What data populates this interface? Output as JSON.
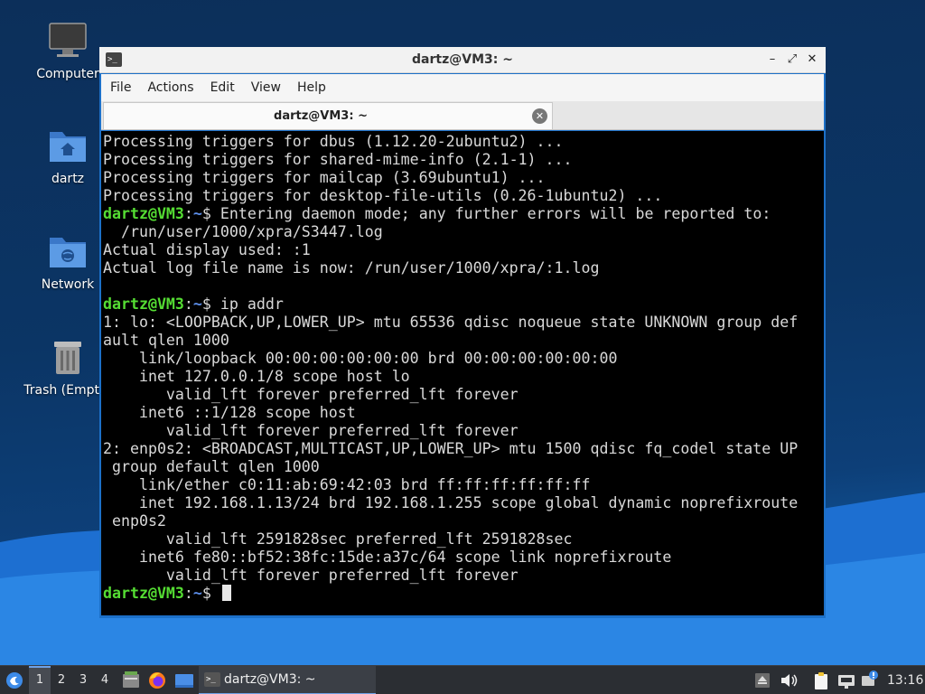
{
  "desktop": {
    "icons": [
      {
        "label": "Computer",
        "icon": "monitor-icon"
      },
      {
        "label": "dartz",
        "icon": "home-folder-icon"
      },
      {
        "label": "Network",
        "icon": "network-folder-icon"
      },
      {
        "label": "Trash (Empty)",
        "icon": "trash-icon"
      }
    ]
  },
  "window": {
    "title": "dartz@VM3: ~",
    "controls": {
      "minimize": "–",
      "maximize": "⤢",
      "close": "✕"
    },
    "menu": [
      "File",
      "Actions",
      "Edit",
      "View",
      "Help"
    ],
    "tab": {
      "label": "dartz@VM3: ~",
      "close": "✕"
    }
  },
  "terminal": {
    "prompt_user": "dartz@VM3",
    "prompt_path": "~",
    "lines": [
      {
        "text": "Processing triggers for dbus (1.12.20-2ubuntu2) ..."
      },
      {
        "text": "Processing triggers for shared-mime-info (2.1-1) ..."
      },
      {
        "text": "Processing triggers for mailcap (3.69ubuntu1) ..."
      },
      {
        "text": "Processing triggers for desktop-file-utils (0.26-1ubuntu2) ..."
      },
      {
        "prompt": true,
        "text": " Entering daemon mode; any further errors will be reported to:"
      },
      {
        "text": "  /run/user/1000/xpra/S3447.log"
      },
      {
        "text": "Actual display used: :1"
      },
      {
        "text": "Actual log file name is now: /run/user/1000/xpra/:1.log"
      },
      {
        "text": ""
      },
      {
        "prompt": true,
        "text": " ip addr"
      },
      {
        "text": "1: lo: <LOOPBACK,UP,LOWER_UP> mtu 65536 qdisc noqueue state UNKNOWN group def"
      },
      {
        "text": "ault qlen 1000"
      },
      {
        "text": "    link/loopback 00:00:00:00:00:00 brd 00:00:00:00:00:00"
      },
      {
        "text": "    inet 127.0.0.1/8 scope host lo"
      },
      {
        "text": "       valid_lft forever preferred_lft forever"
      },
      {
        "text": "    inet6 ::1/128 scope host"
      },
      {
        "text": "       valid_lft forever preferred_lft forever"
      },
      {
        "text": "2: enp0s2: <BROADCAST,MULTICAST,UP,LOWER_UP> mtu 1500 qdisc fq_codel state UP"
      },
      {
        "text": " group default qlen 1000"
      },
      {
        "text": "    link/ether c0:11:ab:69:42:03 brd ff:ff:ff:ff:ff:ff"
      },
      {
        "text": "    inet 192.168.1.13/24 brd 192.168.1.255 scope global dynamic noprefixroute"
      },
      {
        "text": " enp0s2"
      },
      {
        "text": "       valid_lft 2591828sec preferred_lft 2591828sec"
      },
      {
        "text": "    inet6 fe80::bf52:38fc:15de:a37c/64 scope link noprefixroute"
      },
      {
        "text": "       valid_lft forever preferred_lft forever"
      },
      {
        "prompt": true,
        "text": " ",
        "cursor": true
      }
    ]
  },
  "taskbar": {
    "workspaces": [
      "1",
      "2",
      "3",
      "4"
    ],
    "active_workspace": "1",
    "task_label": "dartz@VM3: ~",
    "clock": "13:16"
  },
  "colors": {
    "prompt_user": "#55dd33",
    "prompt_path": "#5c8eea",
    "terminal_bg": "#000000",
    "terminal_fg": "#d9d9d9",
    "window_border": "#1c70c8",
    "taskbar_bg": "#2b2e33"
  }
}
